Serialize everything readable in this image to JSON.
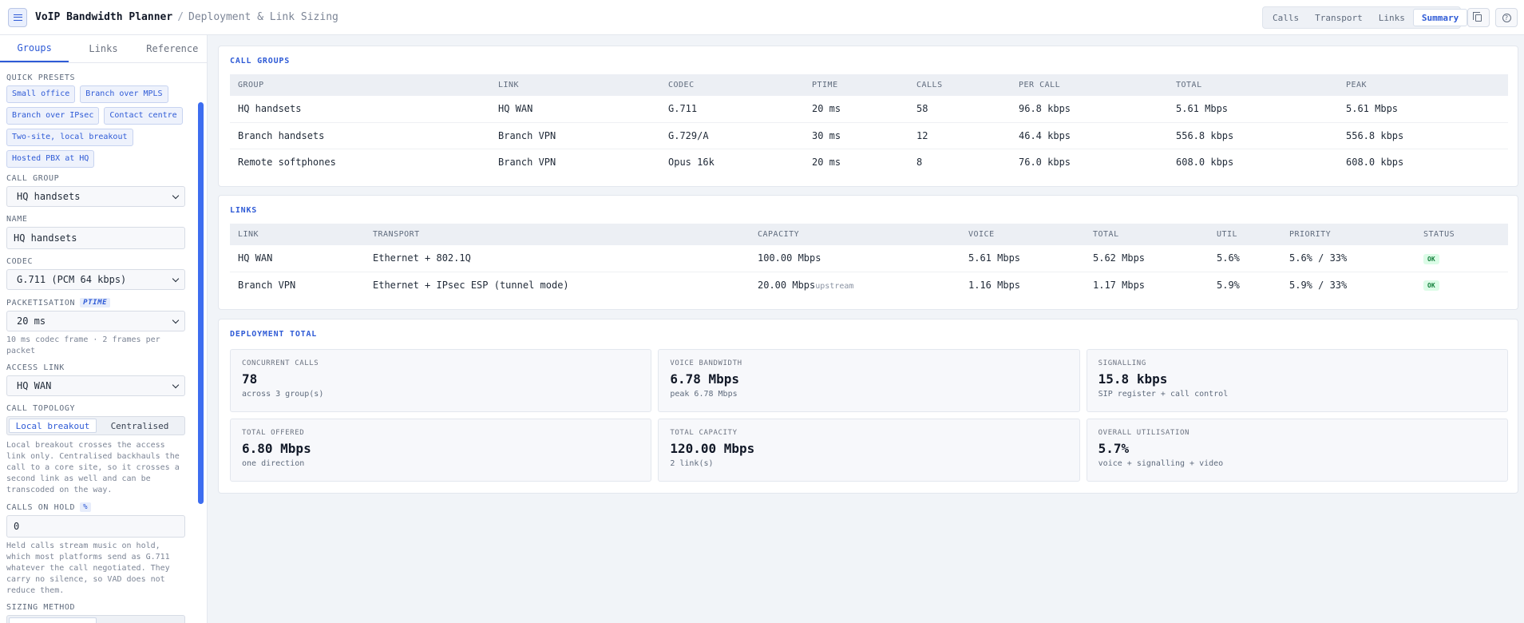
{
  "header": {
    "title": "VoIP Bandwidth Planner",
    "separator": "/",
    "subtitle": "Deployment & Link Sizing",
    "menu_icon": "hamburger-icon",
    "view_tabs": [
      "Calls",
      "Transport",
      "Links",
      "Summary"
    ],
    "active_view": "Summary",
    "copy_icon": "copy-icon",
    "help_icon": "help-icon",
    "help_glyph": "?"
  },
  "sidebar": {
    "tabs": [
      "Groups",
      "Links",
      "Reference"
    ],
    "active_tab": "Groups",
    "presets_label": "QUICK PRESETS",
    "presets": [
      "Small office",
      "Branch over MPLS",
      "Branch over IPsec",
      "Contact centre",
      "Two-site, local breakout",
      "Hosted PBX at HQ"
    ],
    "call_group_label": "CALL GROUP",
    "call_group_value": "HQ handsets",
    "name_label": "NAME",
    "name_value": "HQ handsets",
    "codec_label": "CODEC",
    "codec_value": "G.711 (PCM 64 kbps)",
    "packetisation_label": "PACKETISATION",
    "packetisation_tag": "PTIME",
    "packetisation_value": "20 ms",
    "packetisation_hint": "10 ms codec frame · 2 frames per packet",
    "access_link_label": "ACCESS LINK",
    "access_link_value": "HQ WAN",
    "topology_label": "CALL TOPOLOGY",
    "topology_options": [
      "Local breakout",
      "Centralised"
    ],
    "topology_active": "Local breakout",
    "topology_hint": "Local breakout crosses the access link only. Centralised backhauls the call to a core site, so it crosses a second link as well and can be transcoded on the way.",
    "hold_label": "CALLS ON HOLD",
    "hold_tag": "%",
    "hold_value": "0",
    "hold_hint": "Held calls stream music on hold, which most platforms send as G.711 whatever the call negotiated. They carry no silence, so VAD does not reduce them.",
    "sizing_label": "SIZING METHOD"
  },
  "call_groups": {
    "title": "CALL GROUPS",
    "columns": [
      "GROUP",
      "LINK",
      "CODEC",
      "PTIME",
      "CALLS",
      "PER CALL",
      "TOTAL",
      "PEAK"
    ],
    "rows": [
      [
        "HQ handsets",
        "HQ WAN",
        "G.711",
        "20 ms",
        "58",
        "96.8 kbps",
        "5.61 Mbps",
        "5.61 Mbps"
      ],
      [
        "Branch handsets",
        "Branch VPN",
        "G.729/A",
        "30 ms",
        "12",
        "46.4 kbps",
        "556.8 kbps",
        "556.8 kbps"
      ],
      [
        "Remote softphones",
        "Branch VPN",
        "Opus 16k",
        "20 ms",
        "8",
        "76.0 kbps",
        "608.0 kbps",
        "608.0 kbps"
      ]
    ]
  },
  "links": {
    "title": "LINKS",
    "columns": [
      "LINK",
      "TRANSPORT",
      "CAPACITY",
      "VOICE",
      "TOTAL",
      "UTIL",
      "PRIORITY",
      "STATUS"
    ],
    "rows": [
      {
        "link": "HQ WAN",
        "transport": "Ethernet + 802.1Q",
        "capacity": "100.00 Mbps",
        "capacity_note": "",
        "voice": "5.61 Mbps",
        "total": "5.62 Mbps",
        "util": "5.6%",
        "priority": "5.6% / 33%",
        "status": "OK"
      },
      {
        "link": "Branch VPN",
        "transport": "Ethernet + IPsec ESP (tunnel mode)",
        "capacity": "20.00 Mbps",
        "capacity_note": "upstream",
        "voice": "1.16 Mbps",
        "total": "1.17 Mbps",
        "util": "5.9%",
        "priority": "5.9% / 33%",
        "status": "OK"
      }
    ],
    "status_color": "#15803d"
  },
  "deployment": {
    "title": "DEPLOYMENT TOTAL",
    "stats": [
      {
        "label": "CONCURRENT CALLS",
        "value": "78",
        "sub": "across 3 group(s)"
      },
      {
        "label": "VOICE BANDWIDTH",
        "value": "6.78 Mbps",
        "sub": "peak 6.78 Mbps"
      },
      {
        "label": "SIGNALLING",
        "value": "15.8 kbps",
        "sub": "SIP register + call control"
      },
      {
        "label": "TOTAL OFFERED",
        "value": "6.80 Mbps",
        "sub": "one direction"
      },
      {
        "label": "TOTAL CAPACITY",
        "value": "120.00 Mbps",
        "sub": "2 link(s)"
      },
      {
        "label": "OVERALL UTILISATION",
        "value": "5.7%",
        "sub": "voice + signalling + video"
      }
    ]
  },
  "colors": {
    "accent": "#2f5bd6",
    "scrollbar": "#3d6df0",
    "ok": "#15803d"
  }
}
